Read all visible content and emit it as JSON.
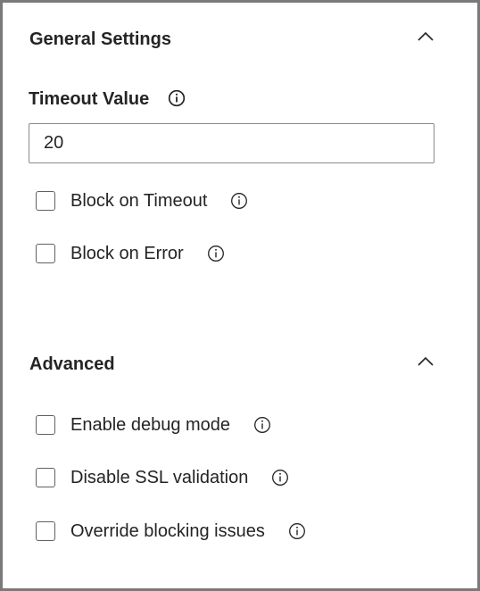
{
  "general": {
    "title": "General Settings",
    "collapse_icon": "chevron-up-icon",
    "timeout": {
      "label": "Timeout Value",
      "info_icon": "info-icon",
      "value": "20"
    },
    "checkboxes": [
      {
        "label": "Block on Timeout",
        "checked": false,
        "info_icon": "info-icon"
      },
      {
        "label": "Block on Error",
        "checked": false,
        "info_icon": "info-icon"
      }
    ]
  },
  "advanced": {
    "title": "Advanced",
    "collapse_icon": "chevron-up-icon",
    "checkboxes": [
      {
        "label": "Enable debug mode",
        "checked": false,
        "info_icon": "info-icon"
      },
      {
        "label": "Disable SSL validation",
        "checked": false,
        "info_icon": "info-icon"
      },
      {
        "label": "Override blocking issues",
        "checked": false,
        "info_icon": "info-icon"
      }
    ]
  },
  "colors": {
    "text": "#242424",
    "border": "#7a7a7a",
    "checkbox_border": "#616161"
  }
}
